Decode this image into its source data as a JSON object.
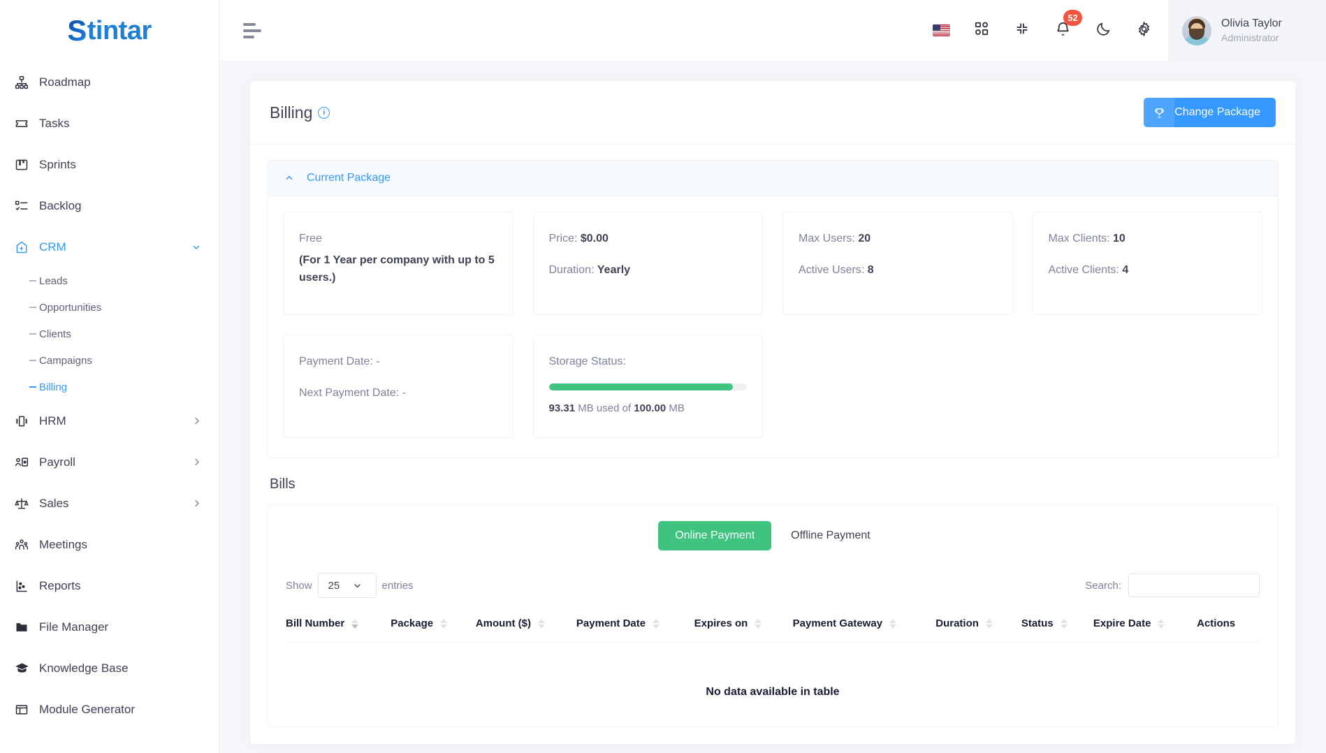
{
  "brand": {
    "logo_first": "S",
    "logo_rest": "tintar"
  },
  "sidebar": {
    "items": [
      {
        "label": "Roadmap",
        "icon": "sitemap-icon",
        "active": false
      },
      {
        "label": "Tasks",
        "icon": "ticket-icon",
        "active": false
      },
      {
        "label": "Sprints",
        "icon": "kanban-icon",
        "active": false
      },
      {
        "label": "Backlog",
        "icon": "checklist-icon",
        "active": false
      },
      {
        "label": "CRM",
        "icon": "crm-icon",
        "active": true,
        "expanded": true
      },
      {
        "label": "HRM",
        "icon": "hrm-icon",
        "active": false
      },
      {
        "label": "Payroll",
        "icon": "payroll-icon",
        "active": false
      },
      {
        "label": "Sales",
        "icon": "scale-icon",
        "active": false
      },
      {
        "label": "Meetings",
        "icon": "people-icon",
        "active": false
      },
      {
        "label": "Reports",
        "icon": "scatter-chart-icon",
        "active": false
      },
      {
        "label": "File Manager",
        "icon": "folder-icon",
        "active": false
      },
      {
        "label": "Knowledge Base",
        "icon": "graduation-cap-icon",
        "active": false
      },
      {
        "label": "Module Generator",
        "icon": "module-icon",
        "active": false
      }
    ],
    "crm_children": [
      {
        "label": "Leads",
        "active": false
      },
      {
        "label": "Opportunities",
        "active": false
      },
      {
        "label": "Clients",
        "active": false
      },
      {
        "label": "Campaigns",
        "active": false
      },
      {
        "label": "Billing",
        "active": true
      }
    ]
  },
  "topbar": {
    "menu_toggle": "menu-toggle",
    "flag": "us-flag-icon",
    "apps": "apps-grid-icon",
    "fullscreen": "collapse-fullscreen-icon",
    "notifications_count": "52",
    "dark_mode": "moon-icon",
    "settings": "gear-icon",
    "user": {
      "name": "Olivia Taylor",
      "role": "Administrator"
    }
  },
  "page": {
    "title": "Billing",
    "change_package_label": "Change Package"
  },
  "current_package": {
    "section_label": "Current Package",
    "tiles": [
      {
        "line1": "Free",
        "line2": "(For 1 Year per company with up to 5 users.)"
      },
      {
        "label1": "Price:",
        "value1": "$0.00",
        "label2": "Duration:",
        "value2": "Yearly"
      },
      {
        "label1": "Max Users:",
        "value1": "20",
        "label2": "Active Users:",
        "value2": "8"
      },
      {
        "label1": "Max Clients:",
        "value1": "10",
        "label2": "Active Clients:",
        "value2": "4"
      }
    ],
    "payment": {
      "label1": "Payment Date:",
      "value1": "-",
      "label2": "Next Payment Date:",
      "value2": "-"
    },
    "storage": {
      "label": "Storage Status:",
      "used": "93.31",
      "used_unit": "MB",
      "mid_text": "used of",
      "total": "100.00",
      "total_unit": "MB",
      "percent": 93
    }
  },
  "bills": {
    "title": "Bills",
    "tabs": [
      {
        "label": "Online Payment",
        "active": true
      },
      {
        "label": "Offline Payment",
        "active": false
      }
    ],
    "show_label": "Show",
    "entries_label": "entries",
    "page_size": "25",
    "search_label": "Search:",
    "search_value": "",
    "search_placeholder": "",
    "columns": [
      {
        "label": "Bill Number",
        "sort": "desc"
      },
      {
        "label": "Package",
        "sort": "none"
      },
      {
        "label": "Amount ($)",
        "sort": "none"
      },
      {
        "label": "Payment Date",
        "sort": "none"
      },
      {
        "label": "Expires on",
        "sort": "none"
      },
      {
        "label": "Payment Gateway",
        "sort": "none"
      },
      {
        "label": "Duration",
        "sort": "none"
      },
      {
        "label": "Status",
        "sort": "none"
      },
      {
        "label": "Expire Date",
        "sort": "none"
      },
      {
        "label": "Actions",
        "sort": "none"
      }
    ],
    "rows": [],
    "empty_text": "No data available in table"
  },
  "colors": {
    "accent_blue": "#3699ff",
    "success_green": "#3fc47f",
    "badge_red": "#f1543f",
    "text_dark": "#3f4254",
    "text_muted": "#7e8299"
  }
}
